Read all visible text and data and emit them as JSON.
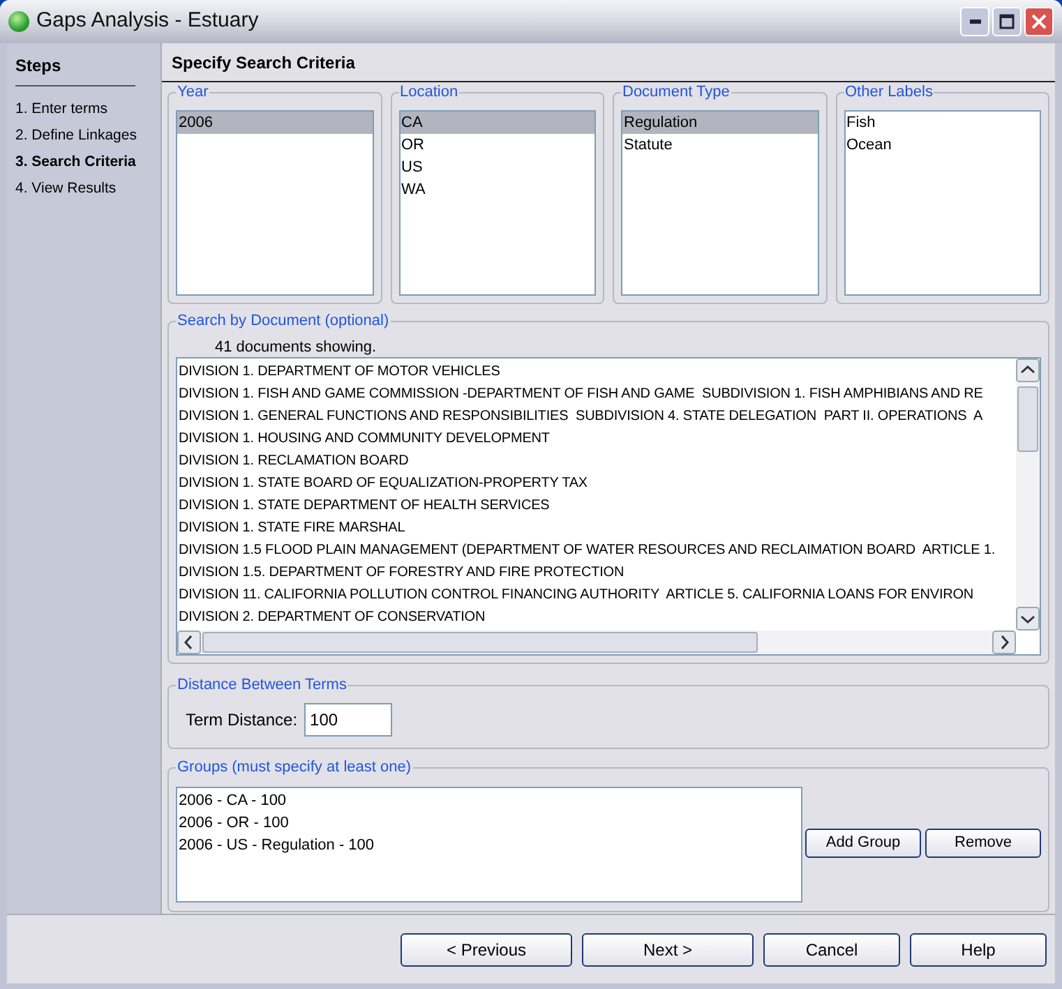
{
  "window": {
    "title": "Gaps Analysis - Estuary"
  },
  "steps": {
    "title": "Steps",
    "items": [
      {
        "label": "1. Enter terms",
        "selected": false
      },
      {
        "label": "2. Define Linkages",
        "selected": false
      },
      {
        "label": "3. Search Criteria",
        "selected": true
      },
      {
        "label": "4. View Results",
        "selected": false
      }
    ]
  },
  "page_title": "Specify Search Criteria",
  "filters": [
    {
      "title": "Year",
      "items": [
        {
          "label": "2006",
          "selected": true
        }
      ]
    },
    {
      "title": "Location",
      "items": [
        {
          "label": "CA",
          "selected": true
        },
        {
          "label": "OR",
          "selected": false
        },
        {
          "label": "US",
          "selected": false
        },
        {
          "label": "WA",
          "selected": false
        }
      ]
    },
    {
      "title": "Document Type",
      "items": [
        {
          "label": "Regulation",
          "selected": true
        },
        {
          "label": "Statute",
          "selected": false
        }
      ]
    },
    {
      "title": "Other Labels",
      "items": [
        {
          "label": "Fish",
          "selected": false
        },
        {
          "label": "Ocean",
          "selected": false
        }
      ]
    }
  ],
  "search_by_document": {
    "title": "Search by Document (optional)",
    "count": "41 documents showing.",
    "documents": [
      "DIVISION 1. DEPARTMENT OF MOTOR VEHICLES",
      "DIVISION 1. FISH AND GAME COMMISSION -DEPARTMENT OF FISH AND GAME  SUBDIVISION 1. FISH AMPHIBIANS AND RE",
      "DIVISION 1. GENERAL FUNCTIONS AND RESPONSIBILITIES  SUBDIVISION 4. STATE DELEGATION  PART II. OPERATIONS  A",
      "DIVISION 1. HOUSING AND COMMUNITY DEVELOPMENT",
      "DIVISION 1. RECLAMATION BOARD",
      "DIVISION 1. STATE BOARD OF EQUALIZATION-PROPERTY TAX",
      "DIVISION 1. STATE DEPARTMENT OF HEALTH SERVICES",
      "DIVISION 1. STATE FIRE MARSHAL",
      "DIVISION 1.5 FLOOD PLAIN MANAGEMENT (DEPARTMENT OF WATER RESOURCES AND RECLAIMATION BOARD  ARTICLE 1.",
      "DIVISION 1.5. DEPARTMENT OF FORESTRY AND FIRE PROTECTION",
      "DIVISION 11. CALIFORNIA POLLUTION CONTROL FINANCING AUTHORITY  ARTICLE 5. CALIFORNIA LOANS FOR ENVIRON",
      "DIVISION 2. DEPARTMENT OF CONSERVATION"
    ]
  },
  "distance": {
    "title": "Distance Between Terms",
    "label": "Term Distance:",
    "value": "100"
  },
  "groups": {
    "title": "Groups (must specify at least one)",
    "items": [
      "2006 - CA - 100",
      "2006 - OR - 100",
      "2006 - US - Regulation - 100"
    ],
    "buttons": [
      "Add Group",
      "Remove"
    ]
  },
  "footer_buttons": [
    "< Previous",
    "Next >",
    "Cancel",
    "Help"
  ]
}
